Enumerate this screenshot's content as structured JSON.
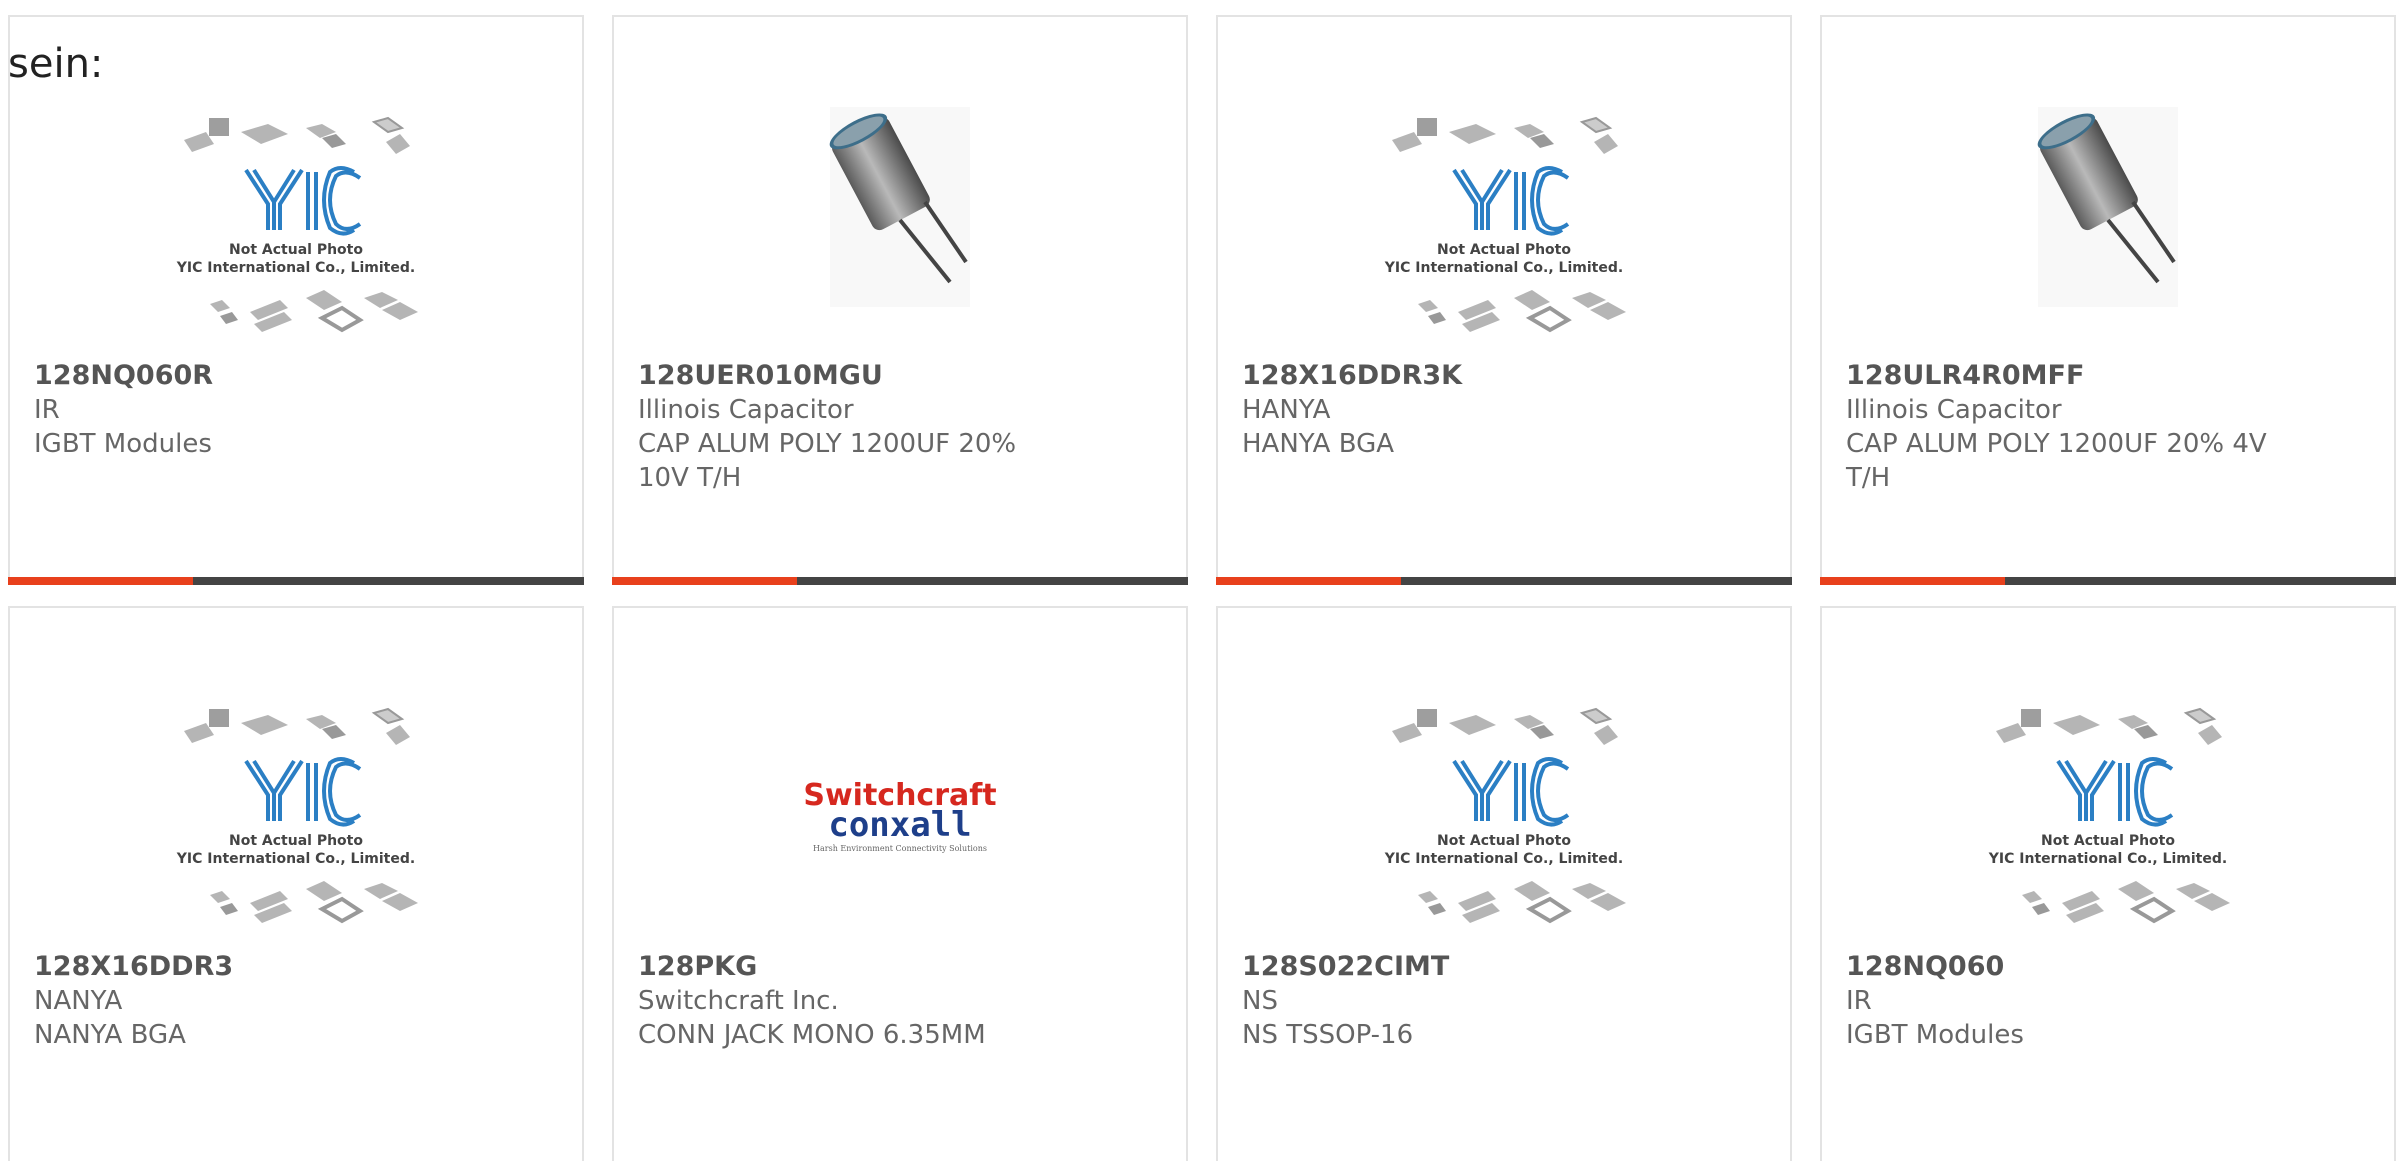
{
  "heading": "sein:",
  "placeholder_photo": {
    "caption_line1": "Not Actual Photo",
    "caption_line2": "YIC International Co., Limited.",
    "logo_text": "YIC"
  },
  "switchcraft_logo": {
    "top": "Switchcraft",
    "bottom": "conxall",
    "tagline": "Harsh Environment Connectivity Solutions"
  },
  "colors": {
    "accent": "#e8401c",
    "bar": "#444444",
    "logo_blue": "#2b7fc4",
    "switchcraft_red": "#d6281f",
    "conxall_blue": "#1e3f8a"
  },
  "products": [
    {
      "part_number": "128NQ060R",
      "manufacturer": "IR",
      "description": "IGBT Modules",
      "image": "placeholder"
    },
    {
      "part_number": "128UER010MGU",
      "manufacturer": "Illinois Capacitor",
      "description": "CAP ALUM POLY 1200UF 20% 10V T/H",
      "image": "capacitor"
    },
    {
      "part_number": "128X16DDR3K",
      "manufacturer": "HANYA",
      "description": "HANYA BGA",
      "image": "placeholder"
    },
    {
      "part_number": "128ULR4R0MFF",
      "manufacturer": "Illinois Capacitor",
      "description": "CAP ALUM POLY 1200UF 20% 4V T/H",
      "image": "capacitor"
    },
    {
      "part_number": "128X16DDR3",
      "manufacturer": "NANYA",
      "description": "NANYA BGA",
      "image": "placeholder"
    },
    {
      "part_number": "128PKG",
      "manufacturer": "Switchcraft Inc.",
      "description": "CONN JACK MONO 6.35MM",
      "image": "switchcraft"
    },
    {
      "part_number": "128S022CIMT",
      "manufacturer": "NS",
      "description": "NS TSSOP-16",
      "image": "placeholder"
    },
    {
      "part_number": "128NQ060",
      "manufacturer": "IR",
      "description": "IGBT Modules",
      "image": "placeholder"
    }
  ]
}
